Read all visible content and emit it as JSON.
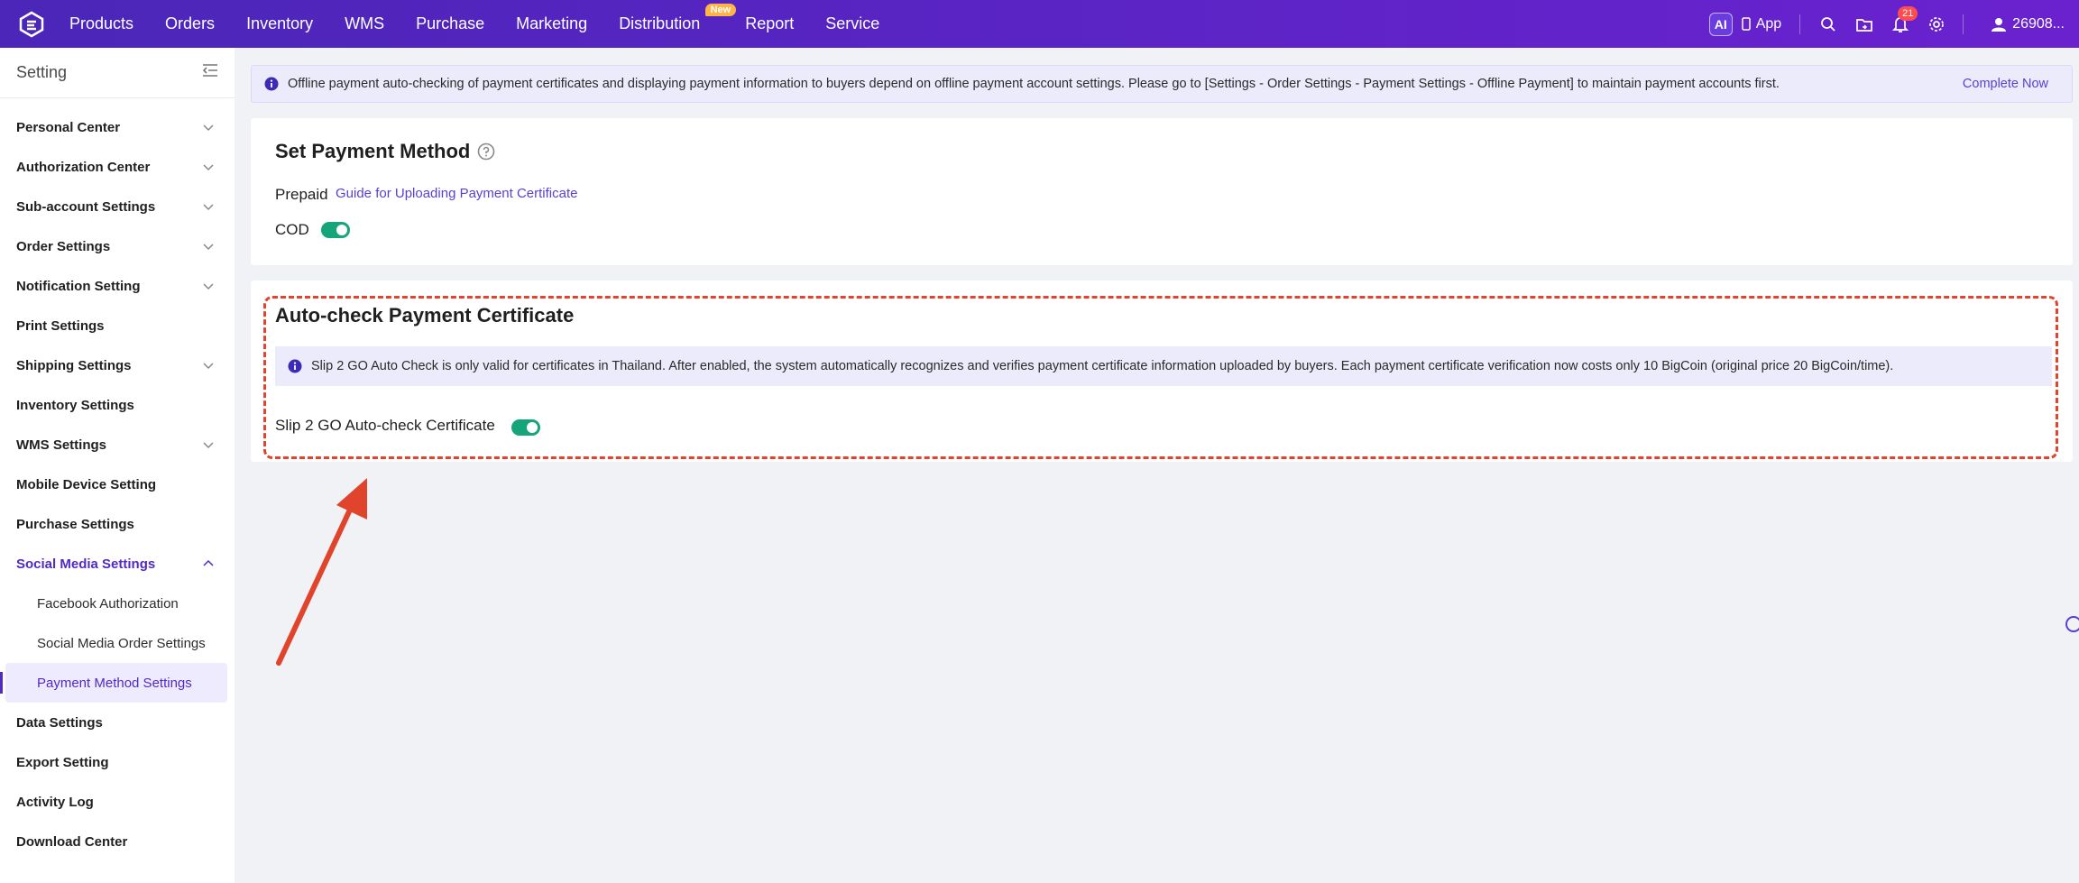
{
  "topbar": {
    "nav": [
      {
        "label": "Products"
      },
      {
        "label": "Orders"
      },
      {
        "label": "Inventory"
      },
      {
        "label": "WMS"
      },
      {
        "label": "Purchase"
      },
      {
        "label": "Marketing"
      },
      {
        "label": "Distribution",
        "badge": "New"
      },
      {
        "label": "Report"
      },
      {
        "label": "Service"
      }
    ],
    "ai_label": "AI",
    "app_label": "App",
    "notification_count": "21",
    "user_label": "26908..."
  },
  "sidebar": {
    "title": "Setting",
    "items": [
      {
        "label": "Personal Center",
        "expandable": true
      },
      {
        "label": "Authorization Center",
        "expandable": true
      },
      {
        "label": "Sub-account Settings",
        "expandable": true
      },
      {
        "label": "Order Settings",
        "expandable": true
      },
      {
        "label": "Notification Setting",
        "expandable": true
      },
      {
        "label": "Print Settings",
        "expandable": false
      },
      {
        "label": "Shipping Settings",
        "expandable": true
      },
      {
        "label": "Inventory Settings",
        "expandable": false
      },
      {
        "label": "WMS Settings",
        "expandable": true
      },
      {
        "label": "Mobile Device Setting",
        "expandable": false
      },
      {
        "label": "Purchase Settings",
        "expandable": false
      },
      {
        "label": "Social Media Settings",
        "expandable": true,
        "open": true
      },
      {
        "label": "Data Settings",
        "expandable": false
      },
      {
        "label": "Export Setting",
        "expandable": false
      },
      {
        "label": "Activity Log",
        "expandable": false
      },
      {
        "label": "Download Center",
        "expandable": false
      }
    ],
    "social_sub": [
      {
        "label": "Facebook Authorization"
      },
      {
        "label": "Social Media Order Settings"
      },
      {
        "label": "Payment Method Settings",
        "active": true
      }
    ]
  },
  "notice": {
    "text": "Offline payment auto-checking of payment certificates and displaying payment information to buyers depend on offline payment account settings. Please go to [Settings - Order Settings - Payment Settings - Offline Payment] to maintain payment accounts first.",
    "action": "Complete Now"
  },
  "payment_method": {
    "title": "Set Payment Method",
    "prepaid_label": "Prepaid",
    "guide_link": "Guide for Uploading Payment Certificate",
    "cod_label": "COD",
    "cod_enabled": true
  },
  "auto_check": {
    "title": "Auto-check Payment Certificate",
    "info": "Slip 2 GO Auto Check is only valid for certificates in Thailand. After enabled, the system automatically recognizes and verifies payment certificate information uploaded by buyers. Each payment certificate verification now costs only 10 BigCoin (original price 20 BigCoin/time).",
    "toggle_label": "Slip 2 GO Auto-check Certificate",
    "enabled": true
  },
  "colors": {
    "accent": "#5129c4",
    "toggle_on": "#16a57a",
    "highlight": "#e0442c"
  }
}
